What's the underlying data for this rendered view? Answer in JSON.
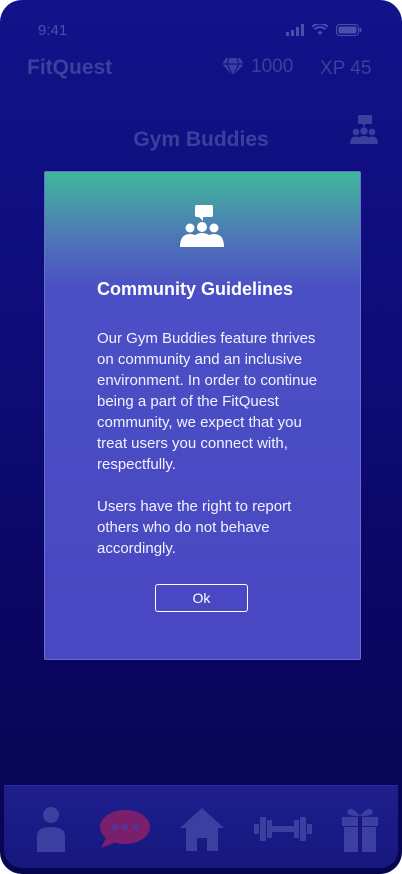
{
  "status": {
    "time": "9:41"
  },
  "topbar": {
    "brand": "FitQuest",
    "gems": "1000",
    "xp": "XP 45"
  },
  "header": {
    "title": "Gym Buddies"
  },
  "modal": {
    "title": "Community Guidelines",
    "paragraphs": [
      "Our Gym Buddies feature thrives on community and an inclusive environment. In order to continue being a part of the FitQuest community, we expect that you treat users you connect with, respectfully.",
      "Users have the right to report others who do not behave accordingly."
    ],
    "ok_label": "Ok"
  },
  "tabs": [
    {
      "icon": "person-icon"
    },
    {
      "icon": "chat-bubble-icon"
    },
    {
      "icon": "home-icon"
    },
    {
      "icon": "dumbbell-icon"
    },
    {
      "icon": "gift-icon"
    }
  ],
  "colors": {
    "dim_ui": "#3c3f9e",
    "modal_purple": "#4947c2",
    "modal_teal": "#3fb89a",
    "chat_accent": "#7a1f6b"
  }
}
